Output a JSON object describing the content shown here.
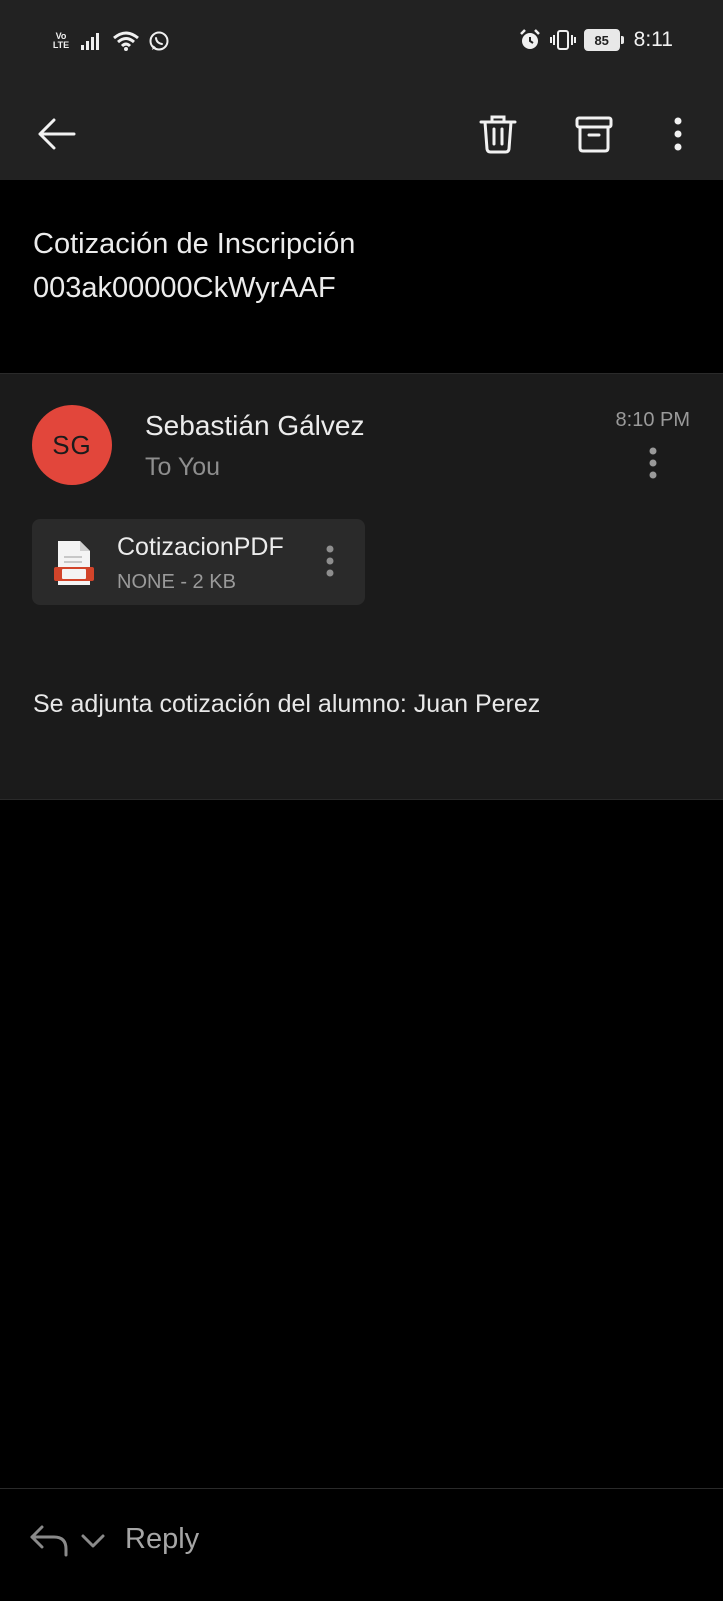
{
  "status_bar": {
    "network_vo": "Vo",
    "network_lte": "LTE",
    "battery_level": "85",
    "time": "8:11",
    "icons": [
      "signal-icon",
      "wifi-icon",
      "whatsapp-icon",
      "alarm-icon",
      "vibrate-icon",
      "battery-icon"
    ]
  },
  "toolbar": {
    "icons": [
      "back-arrow-icon",
      "trash-icon",
      "archive-icon",
      "more-vertical-icon"
    ]
  },
  "email": {
    "subject": "Cotización de Inscripción 003ak00000CkWyrAAF",
    "sender_initials": "SG",
    "sender_name": "Sebastián Gálvez",
    "recipient": "To You",
    "time": "8:10 PM",
    "attachment": {
      "name": "CotizacionPDF",
      "meta": "NONE - 2 KB"
    },
    "body": "Se adjunta cotización del alumno: Juan Perez"
  },
  "reply_bar": {
    "label": "Reply"
  },
  "colors": {
    "avatar": "#e2463b",
    "background": "#000000",
    "card": "#1b1b1b",
    "bars": "#222222"
  }
}
